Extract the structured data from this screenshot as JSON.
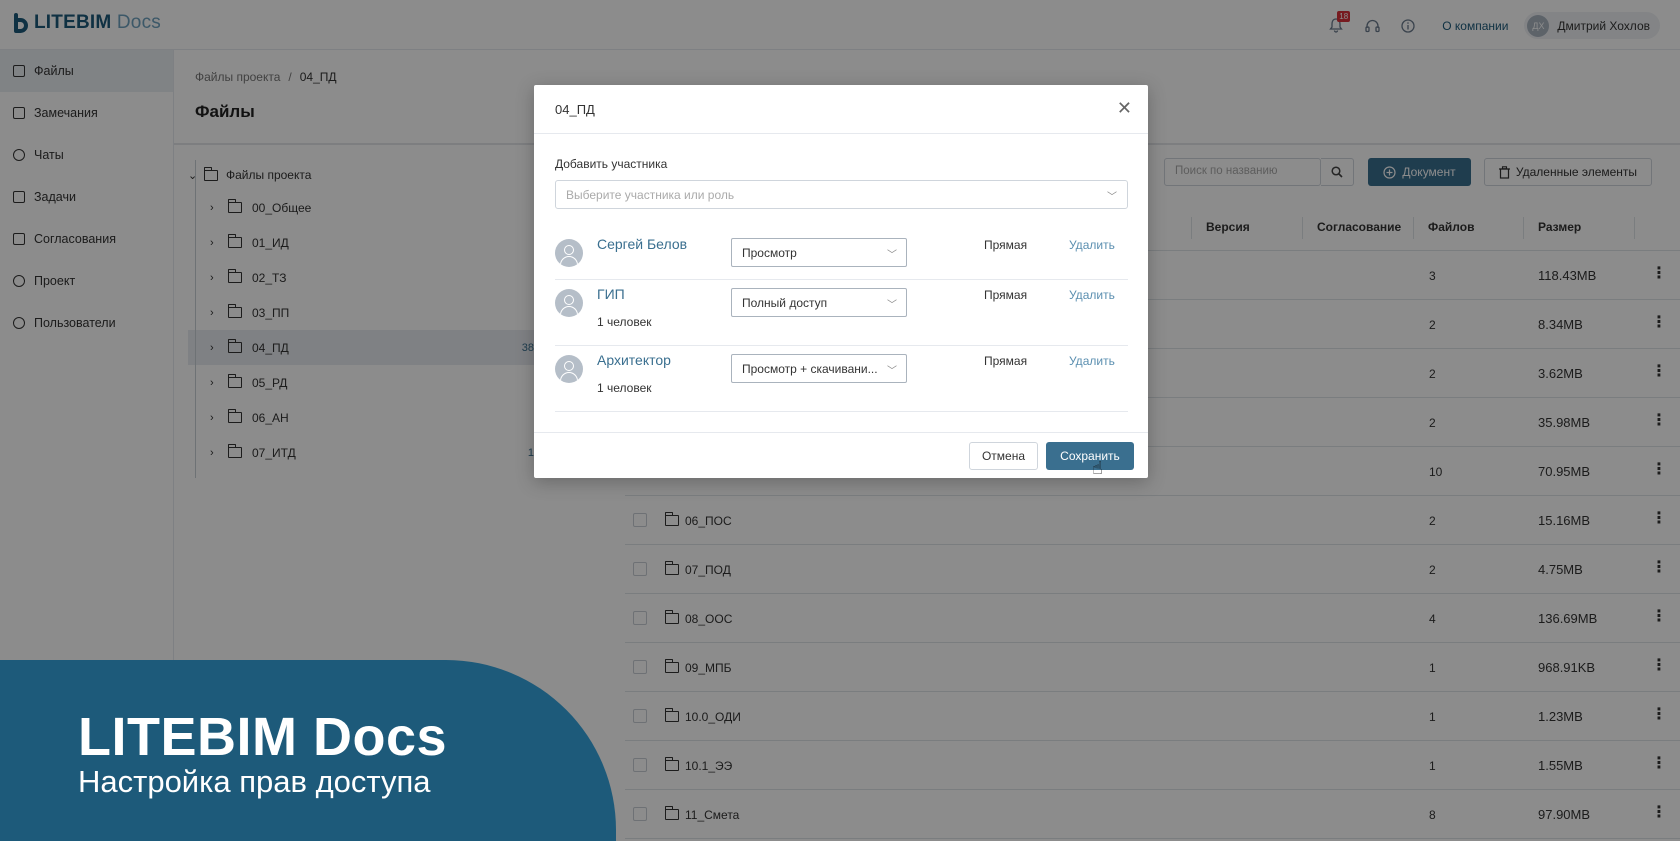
{
  "header": {
    "logo_main": "LITEBIM",
    "logo_sub": "Docs",
    "notifications_count": "18",
    "about_link": "О компании",
    "user_initials": "ДХ",
    "user_name": "Дмитрий Хохлов"
  },
  "sidebar": {
    "items": [
      {
        "label": "Файлы",
        "icon": "file-icon"
      },
      {
        "label": "Замечания",
        "icon": "checkbox-icon"
      },
      {
        "label": "Чаты",
        "icon": "chat-icon"
      },
      {
        "label": "Задачи",
        "icon": "megaphone-icon"
      },
      {
        "label": "Согласования",
        "icon": "clipboard-icon"
      },
      {
        "label": "Проект",
        "icon": "gear-icon"
      },
      {
        "label": "Пользователи",
        "icon": "users-icon"
      }
    ]
  },
  "main": {
    "breadcrumb": [
      "Файлы проекта",
      "/",
      "04_ПД"
    ],
    "title": "Файлы",
    "tree_root": "Файлы проекта",
    "tree": [
      {
        "label": "00_Общее",
        "count": ""
      },
      {
        "label": "01_ИД",
        "count": ""
      },
      {
        "label": "02_ТЗ",
        "count": ""
      },
      {
        "label": "03_ПП",
        "count": ""
      },
      {
        "label": "04_ПД",
        "count": "38"
      },
      {
        "label": "05_РД",
        "count": ""
      },
      {
        "label": "06_АН",
        "count": ""
      },
      {
        "label": "07_ИТД",
        "count": "1"
      }
    ],
    "search_placeholder": "Поиск по названию",
    "document_button": "Документ",
    "deleted_button": "Удаленные элементы",
    "columns": {
      "version": "Версия",
      "approval": "Согласование",
      "files": "Файлов",
      "size": "Размер"
    },
    "rows": [
      {
        "name": "",
        "files": "3",
        "size": "118.43MB"
      },
      {
        "name": "",
        "files": "2",
        "size": "8.34MB"
      },
      {
        "name": "",
        "files": "2",
        "size": "3.62MB"
      },
      {
        "name": "",
        "files": "2",
        "size": "35.98MB"
      },
      {
        "name": "",
        "files": "10",
        "size": "70.95MB"
      },
      {
        "name": "06_ПОС",
        "files": "2",
        "size": "15.16MB"
      },
      {
        "name": "07_ПОД",
        "files": "2",
        "size": "4.75MB"
      },
      {
        "name": "08_ООС",
        "files": "4",
        "size": "136.69MB"
      },
      {
        "name": "09_МПБ",
        "files": "1",
        "size": "968.91KB"
      },
      {
        "name": "10.0_ОДИ",
        "files": "1",
        "size": "1.23MB"
      },
      {
        "name": "10.1_ЭЭ",
        "files": "1",
        "size": "1.55MB"
      },
      {
        "name": "11_Смета",
        "files": "8",
        "size": "97.90MB"
      }
    ]
  },
  "modal": {
    "title": "04_ПД",
    "add_label": "Добавить участника",
    "add_placeholder": "Выберите участника или роль",
    "members": [
      {
        "name": "Сергей Белов",
        "sub": "",
        "access": "Просмотр",
        "type": "Прямая",
        "delete": "Удалить"
      },
      {
        "name": "ГИП",
        "sub": "1 человек",
        "access": "Полный доступ",
        "type": "Прямая",
        "delete": "Удалить"
      },
      {
        "name": "Архитектор",
        "sub": "1 человек",
        "access": "Просмотр + скачивани...",
        "type": "Прямая",
        "delete": "Удалить"
      }
    ],
    "cancel": "Отмена",
    "save": "Сохранить"
  },
  "banner": {
    "title": "LITEBIM Docs",
    "subtitle": "Настройка прав доступа"
  }
}
